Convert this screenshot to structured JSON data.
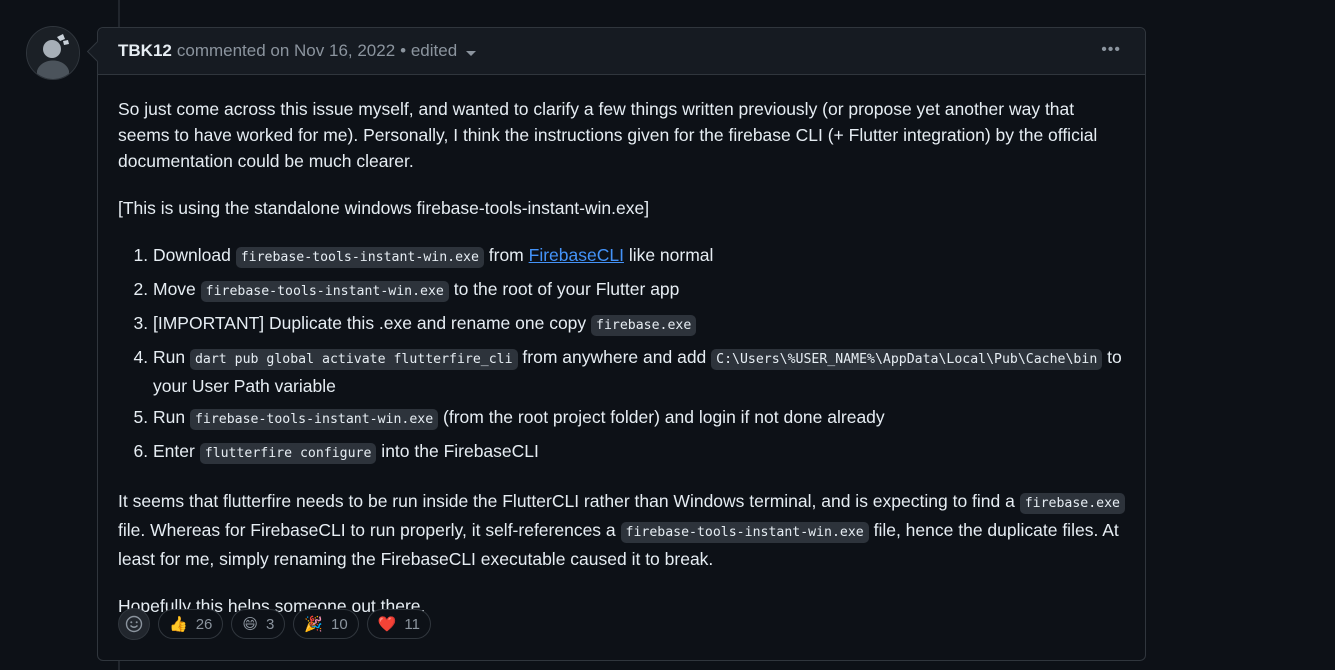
{
  "comment": {
    "author": "TBK12",
    "meta": "commented on Nov 16, 2022",
    "edited": "• edited",
    "menu": "•••",
    "intro": "So just come across this issue myself, and wanted to clarify a few things written previously (or propose yet another way that seems to have worked for me). Personally, I think the instructions given for the firebase CLI (+ Flutter integration) by the official documentation could be much clearer.",
    "note": "[This is using the standalone windows firebase-tools-instant-win.exe]",
    "steps": [
      {
        "t1": "Download ",
        "code1": "firebase-tools-instant-win.exe",
        "t2": " from ",
        "link": "FirebaseCLI",
        "t3": " like normal"
      },
      {
        "t1": "Move ",
        "code1": "firebase-tools-instant-win.exe",
        "t2": " to the root of your Flutter app"
      },
      {
        "t1": "[IMPORTANT] Duplicate this .exe and rename one copy ",
        "code1": "firebase.exe"
      },
      {
        "t1": "Run ",
        "code1": "dart pub global activate flutterfire_cli",
        "t2": " from anywhere and add ",
        "code2": "C:\\Users\\%USER_NAME%\\AppData\\Local\\Pub\\Cache\\bin",
        "t3": " to your User Path variable"
      },
      {
        "t1": "Run ",
        "code1": "firebase-tools-instant-win.exe",
        "t2": " (from the root project folder) and login if not done already"
      },
      {
        "t1": "Enter ",
        "code1": "flutterfire configure",
        "t2": " into the FirebaseCLI"
      }
    ],
    "para3": {
      "t1": "It seems that flutterfire needs to be run inside the FlutterCLI rather than Windows terminal, and is expecting to find a ",
      "code1": "firebase.exe",
      "t2": " file. Whereas for FirebaseCLI to run properly, it self-references a ",
      "code2": "firebase-tools-instant-win.exe",
      "t3": " file, hence the duplicate files. At least for me, simply renaming the FirebaseCLI executable caused it to break."
    },
    "closing": "Hopefully this helps someone out there."
  },
  "reactions": [
    {
      "emoji": "👍",
      "icon": "thumbs-up-icon",
      "count": "26"
    },
    {
      "emoji": "😄",
      "icon": "laugh-icon",
      "count": "3"
    },
    {
      "emoji": "🎉",
      "icon": "hooray-icon",
      "count": "10"
    },
    {
      "emoji": "❤️",
      "icon": "heart-icon",
      "count": "11"
    }
  ]
}
